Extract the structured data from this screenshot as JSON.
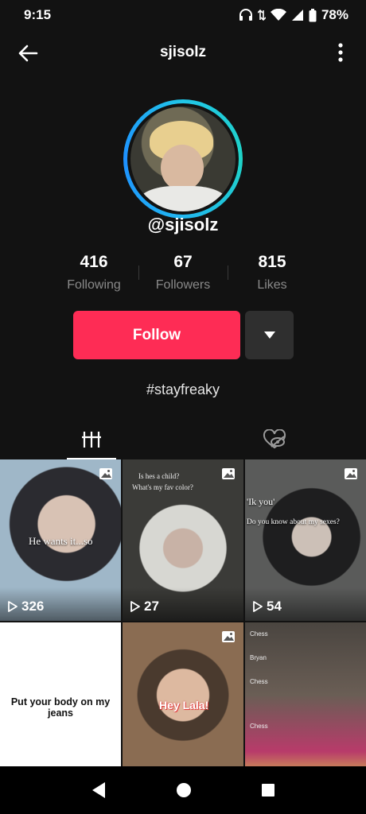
{
  "status_bar": {
    "time": "9:15",
    "battery": "78%"
  },
  "header": {
    "title": "sjisolz"
  },
  "profile": {
    "handle": "@sjisolz",
    "bio": "#stayfreaky"
  },
  "stats": [
    {
      "value": "416",
      "label": "Following"
    },
    {
      "value": "67",
      "label": "Followers"
    },
    {
      "value": "815",
      "label": "Likes"
    }
  ],
  "actions": {
    "follow_label": "Follow"
  },
  "videos": [
    {
      "views": "326",
      "caption": "He wants it...so"
    },
    {
      "views": "27",
      "caption_top1": "Is hes a child?",
      "caption_top2": "What's my fav color?"
    },
    {
      "views": "54",
      "caption_top": "'Ik you'",
      "caption_mid": "Do you know about my sexes?"
    },
    {
      "caption": "Put your body on my jeans"
    },
    {
      "caption": "Hey Lala!"
    },
    {
      "chat": [
        "Chess",
        "Bryan",
        "Chess",
        "Chess"
      ]
    }
  ],
  "colors": {
    "accent": "#fe2c55",
    "background": "#121212",
    "ring": "#21c6e8"
  }
}
